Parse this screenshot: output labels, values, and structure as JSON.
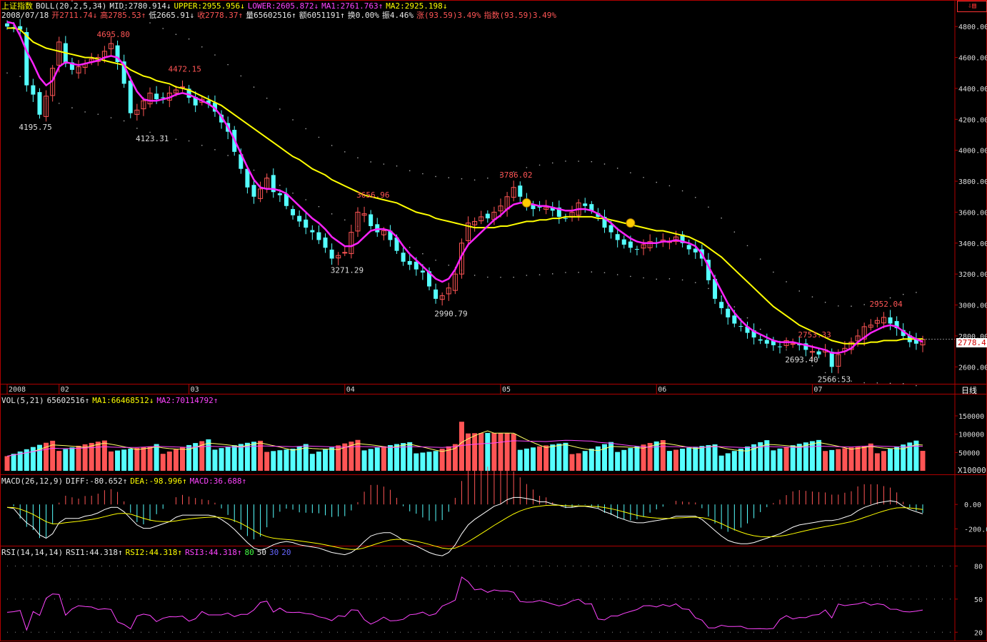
{
  "header": {
    "index_name": "上证指数",
    "boll_label": "BOLL(20,2,5,34)",
    "mid": "MID:2780.914↓",
    "upper": "UPPER:2955.956↓",
    "lower": "LOWER:2605.872↓",
    "ma1": "MA1:2761.763↑",
    "ma2": "MA2:2925.198↓",
    "date": "2008/07/18",
    "open": "开2711.74↓",
    "high": "高2785.53↑",
    "low": "低2665.91↓",
    "close": "收2778.37↑",
    "volume": "量65602516↑",
    "amount": "额6051191↑",
    "turnover": "换0.00%",
    "amplitude": "振4.46%",
    "change": "涨(93.59)3.49%",
    "index_change": "指数(93.59)3.49%",
    "close_tag": "2778.4",
    "period_tab": "日线"
  },
  "vol_header": {
    "label": "VOL(5,21)",
    "value": "65602516↑",
    "ma1": "MA1:66468512↓",
    "ma2": "MA2:70114792↑"
  },
  "macd_header": {
    "label": "MACD(26,12,9)",
    "diff": "DIFF:-80.652↑",
    "dea": "DEA:-98.996↑",
    "macd": "MACD:36.688↑"
  },
  "rsi_header": {
    "label": "RSI(14,14,14)",
    "rsi1": "RSI1:44.318↑",
    "rsi2": "RSI2:44.318↑",
    "rsi3": "RSI3:44.318↑",
    "l80": "80",
    "l50": "50",
    "l30": "30",
    "l20": "20"
  },
  "chart_data": [
    {
      "type": "candlestick",
      "ylim": [
        2500,
        4870
      ],
      "y_ticks": [
        "4800.00",
        "4600.00",
        "4400.00",
        "4200.00",
        "4000.00",
        "3800.00",
        "3600.00",
        "3400.00",
        "3200.00",
        "3000.00",
        "2800.00",
        "2600.00"
      ],
      "y_tick_values": [
        4800,
        4600,
        4400,
        4200,
        4000,
        3800,
        3600,
        3400,
        3200,
        3000,
        2800,
        2600
      ],
      "x_month_labels": [
        {
          "label": "2008",
          "i": 0
        },
        {
          "label": "02",
          "i": 8
        },
        {
          "label": "03",
          "i": 28
        },
        {
          "label": "04",
          "i": 52
        },
        {
          "label": "05",
          "i": 76
        },
        {
          "label": "06",
          "i": 100
        },
        {
          "label": "07",
          "i": 124
        }
      ],
      "annotations": [
        {
          "i": 16,
          "value": 4695.8,
          "text": "4695.80",
          "kind": "high"
        },
        {
          "i": 4,
          "value": 4195.75,
          "text": "4195.75",
          "kind": "low"
        },
        {
          "i": 22,
          "value": 4123.31,
          "text": "4123.31",
          "kind": "low"
        },
        {
          "i": 27,
          "value": 4472.15,
          "text": "4472.15",
          "kind": "high"
        },
        {
          "i": 56,
          "value": 3656.96,
          "text": "3656.96",
          "kind": "high"
        },
        {
          "i": 52,
          "value": 3271.29,
          "text": "3271.29",
          "kind": "low"
        },
        {
          "i": 68,
          "value": 2990.79,
          "text": "2990.79",
          "kind": "low"
        },
        {
          "i": 78,
          "value": 3786.02,
          "text": "3786.02",
          "kind": "high"
        },
        {
          "i": 124,
          "value": 2753.33,
          "text": "2753.33",
          "kind": "high"
        },
        {
          "i": 122,
          "value": 2693.4,
          "text": "2693.40",
          "kind": "low"
        },
        {
          "i": 127,
          "value": 2566.53,
          "text": "2566.53",
          "kind": "low"
        },
        {
          "i": 135,
          "value": 2952.04,
          "text": "2952.04",
          "kind": "high"
        }
      ],
      "close": [
        4800,
        4790,
        4780,
        4420,
        4360,
        4230,
        4350,
        4530,
        4700,
        4560,
        4520,
        4540,
        4560,
        4590,
        4600,
        4640,
        4690,
        4570,
        4430,
        4240,
        4260,
        4320,
        4370,
        4330,
        4340,
        4370,
        4390,
        4410,
        4340,
        4290,
        4330,
        4300,
        4250,
        4180,
        4120,
        3990,
        3880,
        3760,
        3700,
        3750,
        3820,
        3730,
        3710,
        3640,
        3580,
        3540,
        3500,
        3470,
        3420,
        3370,
        3300,
        3320,
        3340,
        3470,
        3600,
        3590,
        3510,
        3470,
        3480,
        3420,
        3350,
        3280,
        3260,
        3230,
        3210,
        3120,
        3040,
        3060,
        3110,
        3200,
        3400,
        3530,
        3540,
        3570,
        3560,
        3600,
        3640,
        3700,
        3760,
        3700,
        3650,
        3620,
        3630,
        3630,
        3610,
        3570,
        3560,
        3600,
        3660,
        3640,
        3610,
        3570,
        3500,
        3470,
        3420,
        3390,
        3370,
        3360,
        3390,
        3410,
        3400,
        3420,
        3410,
        3440,
        3400,
        3360,
        3340,
        3300,
        3160,
        3040,
        2980,
        2920,
        2880,
        2860,
        2820,
        2790,
        2770,
        2750,
        2740,
        2730,
        2770,
        2750,
        2740,
        2710,
        2700,
        2680,
        2710,
        2600,
        2680,
        2720,
        2760,
        2800,
        2860,
        2870,
        2900,
        2920,
        2880,
        2850,
        2800,
        2760,
        2750,
        2778
      ],
      "ma_mid": [
        4790,
        4790,
        4780,
        4740,
        4700,
        4680,
        4660,
        4650,
        4640,
        4630,
        4620,
        4610,
        4600,
        4600,
        4590,
        4580,
        4570,
        4560,
        4550,
        4520,
        4500,
        4480,
        4470,
        4450,
        4440,
        4430,
        4410,
        4400,
        4390,
        4370,
        4350,
        4330,
        4310,
        4290,
        4260,
        4230,
        4200,
        4170,
        4140,
        4110,
        4080,
        4050,
        4020,
        3990,
        3960,
        3940,
        3910,
        3880,
        3860,
        3840,
        3810,
        3790,
        3770,
        3750,
        3730,
        3710,
        3700,
        3690,
        3680,
        3670,
        3660,
        3640,
        3620,
        3600,
        3590,
        3580,
        3560,
        3550,
        3540,
        3530,
        3520,
        3510,
        3500,
        3500,
        3500,
        3500,
        3510,
        3510,
        3520,
        3530,
        3540,
        3540,
        3550,
        3550,
        3560,
        3560,
        3570,
        3570,
        3570,
        3570,
        3570,
        3560,
        3560,
        3550,
        3540,
        3530,
        3520,
        3510,
        3500,
        3490,
        3480,
        3480,
        3470,
        3460,
        3450,
        3440,
        3420,
        3400,
        3370,
        3340,
        3310,
        3270,
        3230,
        3190,
        3150,
        3110,
        3070,
        3030,
        2990,
        2960,
        2930,
        2900,
        2870,
        2850,
        2830,
        2810,
        2790,
        2770,
        2760,
        2750,
        2750,
        2750,
        2750,
        2760,
        2760,
        2770,
        2770,
        2770,
        2780,
        2780,
        2780,
        2781
      ],
      "ma1": [
        4830,
        4820,
        4740,
        4640,
        4560,
        4470,
        4420,
        4450,
        4540,
        4570,
        4560,
        4550,
        4560,
        4570,
        4580,
        4600,
        4610,
        4600,
        4550,
        4460,
        4380,
        4330,
        4320,
        4320,
        4330,
        4340,
        4360,
        4370,
        4360,
        4340,
        4320,
        4300,
        4270,
        4220,
        4150,
        4070,
        3980,
        3890,
        3810,
        3760,
        3750,
        3750,
        3740,
        3720,
        3680,
        3640,
        3600,
        3560,
        3530,
        3490,
        3440,
        3410,
        3380,
        3380,
        3400,
        3440,
        3480,
        3490,
        3490,
        3480,
        3440,
        3380,
        3330,
        3290,
        3250,
        3210,
        3170,
        3150,
        3170,
        3230,
        3320,
        3390,
        3430,
        3470,
        3510,
        3550,
        3580,
        3620,
        3650,
        3660,
        3660,
        3650,
        3640,
        3640,
        3630,
        3620,
        3610,
        3610,
        3620,
        3620,
        3610,
        3590,
        3560,
        3530,
        3490,
        3460,
        3430,
        3410,
        3400,
        3400,
        3400,
        3410,
        3410,
        3420,
        3410,
        3400,
        3380,
        3330,
        3250,
        3170,
        3090,
        3010,
        2950,
        2900,
        2860,
        2830,
        2810,
        2790,
        2770,
        2760,
        2760,
        2760,
        2750,
        2740,
        2730,
        2720,
        2710,
        2690,
        2690,
        2700,
        2720,
        2760,
        2790,
        2820,
        2840,
        2860,
        2870,
        2860,
        2830,
        2800,
        2780,
        2762
      ],
      "vol_ticks": [
        "150000",
        "100000",
        "50000"
      ],
      "vol_tick_values": [
        150000,
        100000,
        50000
      ],
      "vol_unit": "X10000",
      "vol_ylim": [
        0,
        185000
      ],
      "macd_ticks": [
        "0.00",
        "-200.00"
      ],
      "macd_tick_values": [
        0,
        -200
      ],
      "macd_ylim": [
        -320,
        170
      ],
      "rsi_ticks": [
        "80",
        "50",
        "20"
      ],
      "rsi_tick_values": [
        80,
        50,
        20
      ],
      "rsi_ylim": [
        15,
        90
      ]
    }
  ]
}
